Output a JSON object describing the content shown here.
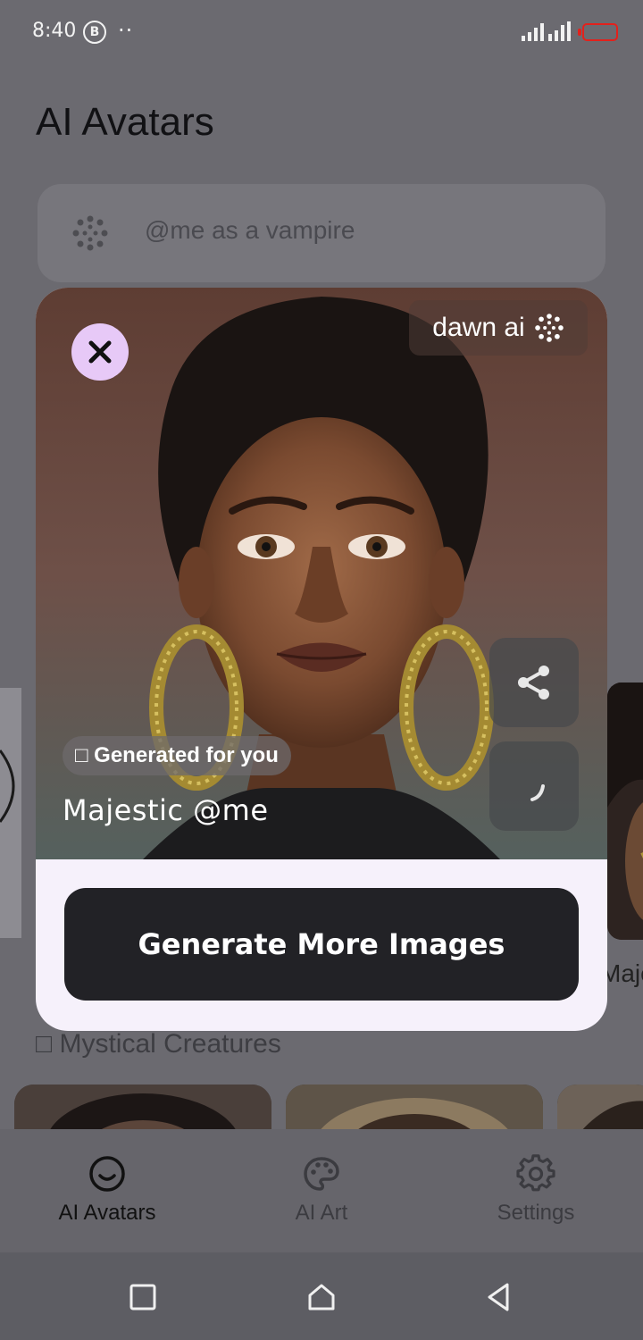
{
  "status_bar": {
    "time": "8:40",
    "b_badge": "B",
    "dots": "··",
    "battery_color": "#e3211c"
  },
  "page": {
    "title": "AI Avatars",
    "search_placeholder": "@me as a vampire",
    "side_card_label": "Maje",
    "section_title": "□ Mystical Creatures"
  },
  "modal": {
    "brand": "dawn ai",
    "generated_badge": "□ Generated for you",
    "caption": "Majestic @me",
    "generate_button": "Generate More Images",
    "accent_color": "#e7c9f7"
  },
  "bottom_nav": {
    "items": [
      {
        "label": "AI Avatars",
        "icon": "smiley-face-icon",
        "active": true
      },
      {
        "label": "AI Art",
        "icon": "palette-icon",
        "active": false
      },
      {
        "label": "Settings",
        "icon": "gear-icon",
        "active": false
      }
    ]
  },
  "system_nav": {
    "icons": [
      "recents-square-icon",
      "home-icon",
      "back-triangle-icon"
    ]
  }
}
